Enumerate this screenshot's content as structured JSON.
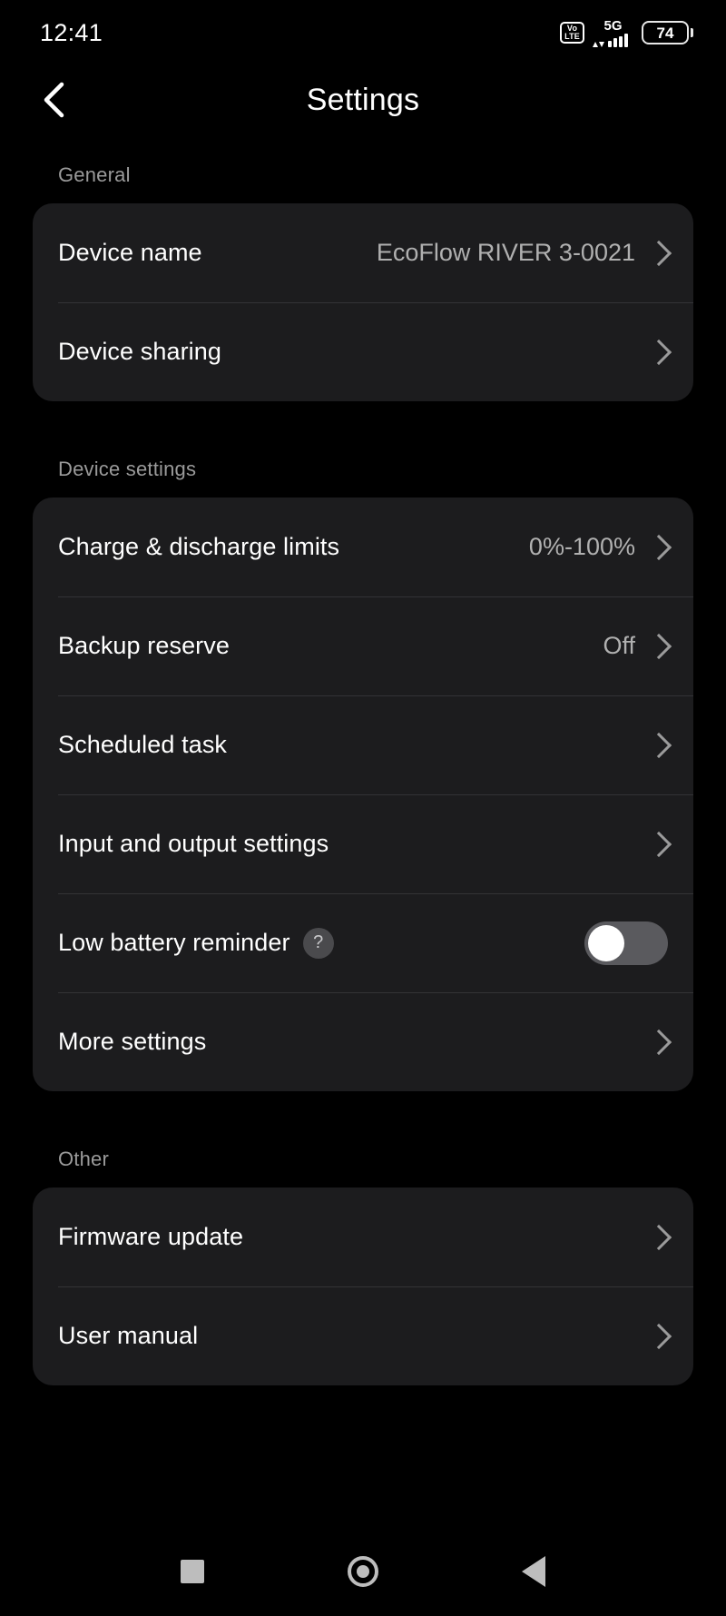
{
  "status_bar": {
    "time": "12:41",
    "volte_top": "Vo",
    "volte_bottom": "LTE",
    "network": "5G",
    "battery_level": "74"
  },
  "header": {
    "title": "Settings",
    "back_icon": "chevron-left-icon"
  },
  "sections": [
    {
      "label": "General",
      "rows": [
        {
          "label": "Device name",
          "value": "EcoFlow RIVER 3-0021",
          "control": "chevron"
        },
        {
          "label": "Device sharing",
          "value": "",
          "control": "chevron"
        }
      ]
    },
    {
      "label": "Device settings",
      "rows": [
        {
          "label": "Charge & discharge limits",
          "value": "0%-100%",
          "control": "chevron"
        },
        {
          "label": "Backup reserve",
          "value": "Off",
          "control": "chevron"
        },
        {
          "label": "Scheduled task",
          "value": "",
          "control": "chevron"
        },
        {
          "label": "Input and output settings",
          "value": "",
          "control": "chevron"
        },
        {
          "label": "Low battery reminder",
          "value": "",
          "control": "toggle",
          "help": "?",
          "toggle_state": "on"
        },
        {
          "label": "More settings",
          "value": "",
          "control": "chevron"
        }
      ]
    },
    {
      "label": "Other",
      "rows": [
        {
          "label": "Firmware update",
          "value": "",
          "control": "chevron"
        },
        {
          "label": "User manual",
          "value": "",
          "control": "chevron"
        }
      ]
    }
  ],
  "nav_bar": {
    "recents_icon": "square-icon",
    "home_icon": "circle-icon",
    "back_icon": "triangle-back-icon"
  },
  "colors": {
    "background": "#000000",
    "card": "#1c1c1e",
    "divider": "#333336",
    "label": "#ffffff",
    "value": "#b0b0b0",
    "section_label": "#9a9a9a",
    "toggle_track": "#5a5a5e",
    "toggle_knob": "#ffffff"
  }
}
